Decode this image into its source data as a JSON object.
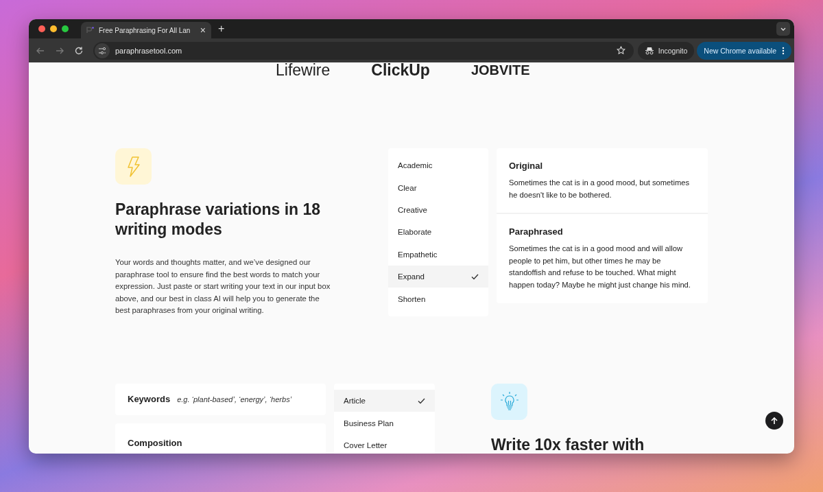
{
  "browser": {
    "tab_title": "Free Paraphrasing For All Lan",
    "tab_close": "×",
    "new_tab": "+",
    "url": "paraphrasetool.com",
    "incognito": "Incognito",
    "update_button": "New Chrome available"
  },
  "logos": [
    "Lifewire",
    "ClickUp",
    "JOBVITE"
  ],
  "modes_section": {
    "title": "Paraphrase variations in 18 writing modes",
    "description": "Your words and thoughts matter, and we’ve designed our paraphrase tool to ensure find the best words to match your expression. Just paste or start writing your text in our input box above, and our best in class AI will help you to generate the best paraphrases from your original writing.",
    "modes": [
      {
        "label": "Academic",
        "selected": false
      },
      {
        "label": "Clear",
        "selected": false
      },
      {
        "label": "Creative",
        "selected": false
      },
      {
        "label": "Elaborate",
        "selected": false
      },
      {
        "label": "Empathetic",
        "selected": false
      },
      {
        "label": "Expand",
        "selected": true
      },
      {
        "label": "Shorten",
        "selected": false
      }
    ],
    "original": {
      "heading": "Original",
      "text": "Sometimes the cat is in a good mood, but sometimes he doesn't like to be bothered."
    },
    "paraphrased": {
      "heading": "Paraphrased",
      "text": "Sometimes the cat is in a good mood and will allow people to pet him, but other times he may be standoffish and refuse to be touched. What might happen today? Maybe he might just change his mind."
    }
  },
  "writer_section": {
    "keywords_label": "Keywords",
    "keywords_placeholder": "e.g. ‘plant-based’, ‘energy’, ‘herbs’",
    "composition_label": "Composition",
    "doc_types": [
      {
        "label": "Article",
        "selected": true
      },
      {
        "label": "Business Plan",
        "selected": false
      },
      {
        "label": "Cover Letter",
        "selected": false
      }
    ],
    "title": "Write 10x faster with"
  }
}
